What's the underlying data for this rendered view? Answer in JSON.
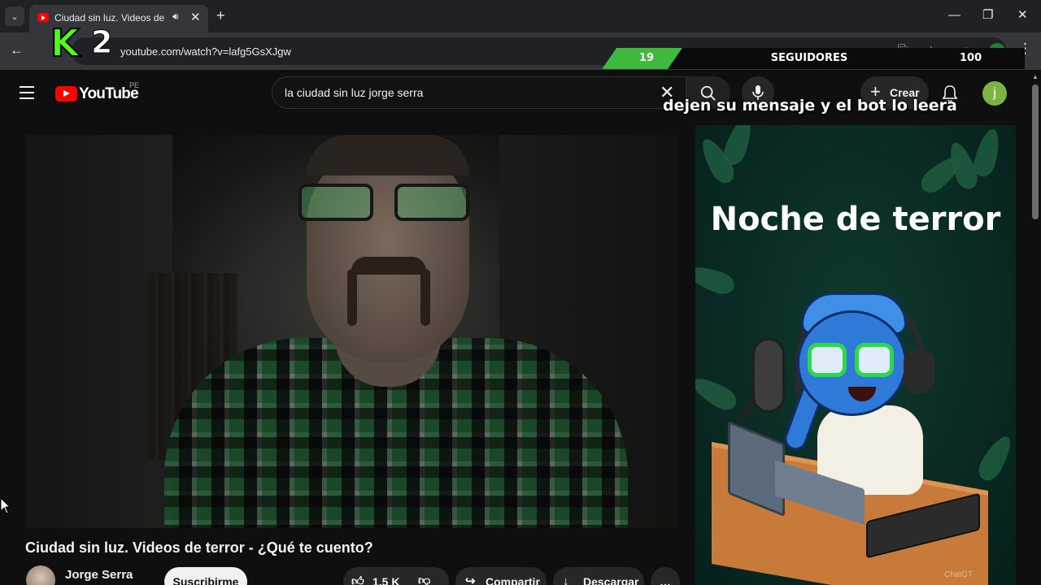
{
  "browser": {
    "tab_title": "Ciudad sin luz. Videos de terror - ¿Qué te cuento?",
    "url": "youtube.com/watch?v=lafg5GsXJgw"
  },
  "stream_overlay": {
    "logo_text": "2",
    "followers_current": "19",
    "followers_label": "SEGUIDORES",
    "followers_goal": "100",
    "followers_progress_fraction": 0.19,
    "tts_message": "dejen su mensaje y el bot lo leera",
    "accent_color": "#53fc18"
  },
  "youtube": {
    "logo_text": "YouTube",
    "country_code": "PE",
    "search_query": "la ciudad sin luz jorge serra",
    "create_label": "Crear",
    "avatar_letter": "j"
  },
  "video": {
    "title": "Ciudad sin luz. Videos de terror - ¿Qué te cuento?",
    "channel_name": "Jorge Serra",
    "subscribe_label": "Suscribirme",
    "likes": "1.5 K",
    "share_label": "Compartir",
    "download_label": "Descargar"
  },
  "side_panel": {
    "title": "Noche de terror",
    "watermark": "ChatGT"
  },
  "colors": {
    "yt_red": "#ff0000",
    "background": "#0f0f0f",
    "panel_green": "#0a2b24"
  }
}
